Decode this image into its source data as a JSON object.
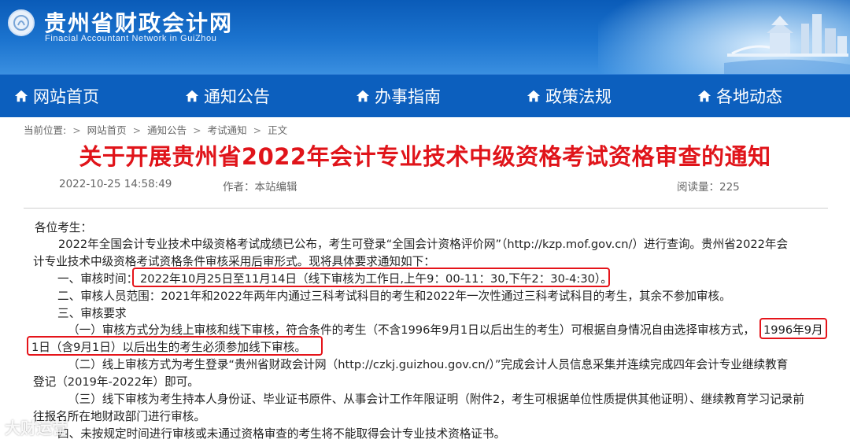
{
  "header": {
    "site_title": "贵州省财政会计网",
    "site_subtitle": "Finacial  Accountant Network in GuiZhou"
  },
  "nav": [
    {
      "label": "网站首页",
      "icon": "home-icon"
    },
    {
      "label": "通知公告",
      "icon": "home-icon"
    },
    {
      "label": "办事指南",
      "icon": "home-icon"
    },
    {
      "label": "政策法规",
      "icon": "home-icon"
    },
    {
      "label": "各地动态",
      "icon": "home-icon"
    }
  ],
  "breadcrumb": {
    "prefix": "当前位置:",
    "items": [
      "网站首页",
      "通知公告",
      "考试通知",
      "正文"
    ],
    "separator": ">"
  },
  "article": {
    "title": "关于开展贵州省2022年会计专业技术中级资格考试资格审查的通知",
    "datetime": "2022-10-25 14:58:49",
    "author": "作者：本站编辑",
    "views": "阅读量：225",
    "lines": [
      "各位考生：",
      "2022年全国会计专业技术中级资格考试成绩已公布，考生可登录“全国会计资格评价网”（http://kzp.mof.gov.cn/）进行查询。贵州省2022年会",
      "计专业技术中级资格考试资格条件审核采用后审形式。现将具体要求通知如下：",
      "一、审核时间：",
      "2022年10月25日至11月14日（线下审核为工作日,上午9：00-11：30,下午2：30-4:30）。",
      "二、审核人员范围：2021年和2022年两年内通过三科考试科目的考生和2022年一次性通过三科考试科目的考生，其余不参加审核。",
      "三、审核要求",
      "（一）审核方式分为线上审核和线下审核，符合条件的考生（不含1996年9月1日以后出生的考生）可根据自身情况自由选择审核方式，",
      "1996年9月",
      "1日（含9月1日）以后出生的考生必须参加线下审核。",
      "（二）线上审核方式为考生登录“贵州省财政会计网（http://czkj.guizhou.gov.cn/）”完成会计人员信息采集并连续完成四年会计专业继续教育",
      "登记（2019年-2022年）即可。",
      "（三）线下审核为考生持本人身份证、毕业证书原件、从事会计工作年限证明（附件2，考生可根据单位性质提供其他证明）、继续教育学习记录前",
      "往报名所在地财政部门进行审核。",
      "四、未按规定时间进行审核或未通过资格审查的考生将不能取得会计专业技术资格证书。"
    ]
  },
  "watermark": "大财运营",
  "colors": {
    "nav_bg": "#0c5fbe",
    "title_red": "#e0141a",
    "highlight_red": "#e5141a"
  }
}
